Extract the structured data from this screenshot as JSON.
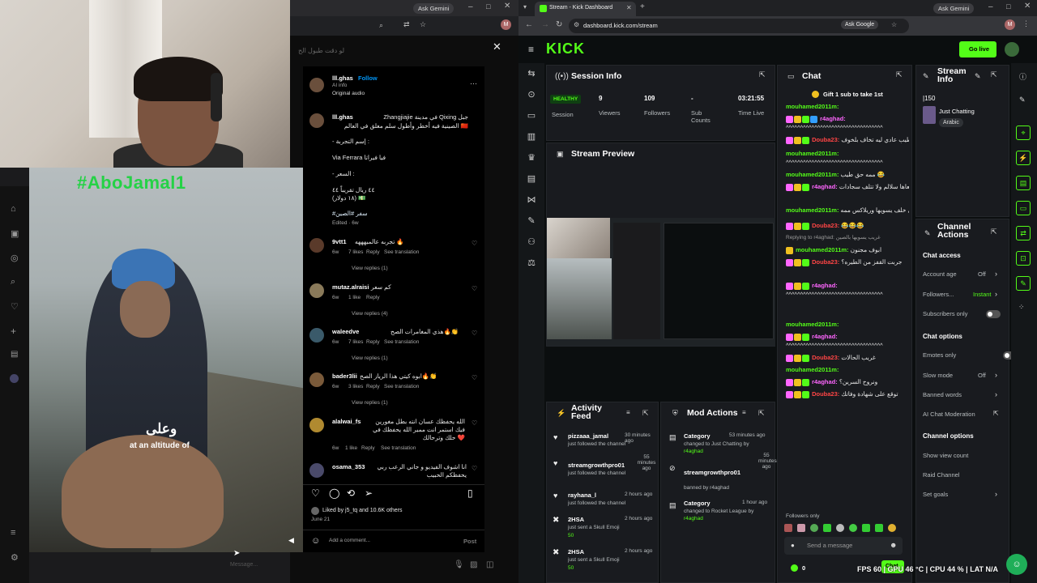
{
  "left_browser": {
    "ask_gemini": "Ask Gemini",
    "ig_header_text": "لو دقت طبول الح",
    "post": {
      "author": "lll.ghas",
      "follow": "Follow",
      "subtitle": "AI info",
      "audio": "Original audio",
      "caption_user": "lll.ghas",
      "caption_lines": [
        "Zhangjiajie في مدينة Qixing جبل",
        "الصينية فيه أخطر وأطول سلم معلق في العالم 🇨🇳",
        "- إسم التجربة :",
        "Via Ferrara فيا فيراتا",
        "- السعر :",
        "٤٤ ريال تقريباً ٤٤",
        "(١٨ دولار) 💵"
      ],
      "hashtag": "#سفر #الصين",
      "edited": "Edited · 6w"
    },
    "comments": [
      {
        "user": "9vtt1",
        "text": "تجربه عالميهههه 🔥",
        "time": "6w",
        "likes": "7 likes",
        "reply": "Reply",
        "translate": "See translation",
        "replies": "View replies (1)"
      },
      {
        "user": "mutaz.alraisi",
        "text": "كم سعر",
        "time": "6w",
        "likes": "1 like",
        "reply": "Reply",
        "translate": "",
        "replies": "View replies (4)"
      },
      {
        "user": "waleedve",
        "text": "هذي المغامرات الصح🔥👏",
        "time": "6w",
        "likes": "7 likes",
        "reply": "Reply",
        "translate": "See translation",
        "replies": "View replies (1)"
      },
      {
        "user": "bader3lii",
        "text": "ابوه كيتي هذا الرياز الصح🔥👏",
        "time": "6w",
        "likes": "3 likes",
        "reply": "Reply",
        "translate": "See translation",
        "replies": "View replies (1)"
      },
      {
        "user": "alalwai_fs",
        "text": "الله يحفظك عسان انته بطل مغورين فيك استمر انت ممير الله يحفظك في حلك وترحالك ❤️",
        "time": "6w",
        "likes": "1 like",
        "reply": "Reply",
        "translate": "See translation",
        "replies": ""
      },
      {
        "user": "osama_353",
        "text": "انا اشوف الفيديو و جاني الرعب ربي يحفظكم الحبيب",
        "time": "",
        "likes": "",
        "reply": "",
        "translate": "",
        "replies": ""
      }
    ],
    "liked_by": "Liked by j5_tq and 10.6K others",
    "date": "June 21",
    "add_comment": "Add a comment...",
    "post_btn": "Post",
    "overlay_tag": "#AboJamal1",
    "caption_ar": "وعلى",
    "caption_en": "at an altitude of",
    "message_placeholder": "Message..."
  },
  "right_browser": {
    "tab_title": "Stream - Kick Dashboard",
    "url": "dashboard.kick.com/stream",
    "ask_google": "Ask Google",
    "ask_gemini": "Ask Gemini",
    "logo": "KICK",
    "go_live": "Go live",
    "session": {
      "title": "Session Info",
      "status": "HEALTHY",
      "status_label": "Session",
      "viewers": "9",
      "viewers_label": "Viewers",
      "followers": "109",
      "followers_label": "Followers",
      "subs": "-",
      "subs_label": "Sub Counts",
      "time": "03:21:55",
      "time_label": "Time Live"
    },
    "preview_title": "Stream Preview",
    "activity": {
      "title": "Activity Feed",
      "items": [
        {
          "user": "pizzaaa_jamal",
          "action": "just followed the channel",
          "time": "30 minutes ago"
        },
        {
          "user": "streamgrowthpro01",
          "action": "just followed the channel",
          "time": "55 minutes ago"
        },
        {
          "user": "rayhana_l",
          "action": "just followed the channel",
          "time": "2 hours ago"
        },
        {
          "user": "2HSA",
          "action": "just sent a Skull Emoji",
          "time": "2 hours ago",
          "amount": "50"
        },
        {
          "user": "2HSA",
          "action": "just sent a Skull Emoji",
          "time": "2 hours ago",
          "amount": "50"
        }
      ]
    },
    "mod": {
      "title": "Mod Actions",
      "items": [
        {
          "title": "Category",
          "line1": "changed to Just Chatting by",
          "line2": "r4aghad",
          "time": "53 minutes ago"
        },
        {
          "title": "streamgrowthpro01",
          "line1": "banned by r4aghad",
          "line2": "",
          "time": "55 minutes ago"
        },
        {
          "title": "Category",
          "line1": "changed to Rocket League by",
          "line2": "r4aghad",
          "time": "1 hour ago"
        }
      ]
    },
    "chat": {
      "title": "Chat",
      "pinned": "Gift 1 sub to take 1st",
      "lines": [
        {
          "user": "mouhamed2011m:",
          "cls": "cu-g",
          "text": ""
        },
        {
          "user": "r4aghad:",
          "cls": "cu-p",
          "text": "^^^^^^^^^^^^^^^^^^^^^^^^^^^^^^^^^^"
        },
        {
          "user": "Douba23:",
          "cls": "cu-r",
          "text": "طيب عادي ليه تخاف بلخوف"
        },
        {
          "user": "mouhamed2011m:",
          "cls": "cu-g",
          "text": "^^^^^^^^^^^^^^^^^^^^^^^^^^^^^^^^^^"
        },
        {
          "user": "mouhamed2011m:",
          "cls": "cu-g",
          "text": "ممه حق طيب 😂"
        },
        {
          "user": "r4aghad:",
          "cls": "cu-p",
          "text": "السالفه زيي ليها كلاب بكيك بس احط معاها سلالم ولا تتلف سجادات"
        },
        {
          "user": "mouhamed2011m:",
          "cls": "cu-g",
          "text": "الي خلف يسويها وريلاكس ممه"
        },
        {
          "user": "Douba23:",
          "cls": "cu-r",
          "text": "😂😂😂"
        },
        {
          "user": "",
          "cls": "",
          "text": "Replying to r4aghad: غريب يسويها بالصين"
        },
        {
          "user": "mouhamed2011m:",
          "cls": "cu-g",
          "text": "ابوف مجنون"
        },
        {
          "user": "Douba23:",
          "cls": "cu-r",
          "text": "جربت القفز من الطيره؟"
        },
        {
          "user": "r4aghad:",
          "cls": "cu-p",
          "text": "^^^^^^^^^^^^^^^^^^^^^^^^^^^^^^^^^^"
        },
        {
          "user": "mouhamed2011m:",
          "cls": "cu-g",
          "text": ""
        },
        {
          "user": "r4aghad:",
          "cls": "cu-p",
          "text": "^^^^^^^^^^^^^^^^^^^^^^^^^^^^^^^^^^"
        },
        {
          "user": "Douba23:",
          "cls": "cu-r",
          "text": "غريب الحالات"
        },
        {
          "user": "mouhamed2011m:",
          "cls": "cu-g",
          "text": ""
        },
        {
          "user": "r4aghad:",
          "cls": "cu-p",
          "text": "ونروح السرين؟"
        },
        {
          "user": "Douba23:",
          "cls": "cu-r",
          "text": "توقع على شهادة وفاتك"
        }
      ],
      "followers_only": "Followers only",
      "send_placeholder": "Send a message",
      "points": "0",
      "chat_btn": "Chat"
    },
    "stream_info": {
      "title": "Stream Info",
      "name": "|150",
      "category": "Just Chatting",
      "tag": "Arabic"
    },
    "channel_actions": {
      "title": "Channel Actions",
      "chat_access": "Chat access",
      "account_age": "Account age",
      "account_age_val": "Off",
      "followers": "Followers...",
      "followers_val": "Instant",
      "subscribers_only": "Subscribers only",
      "chat_options": "Chat options",
      "emotes_only": "Emotes only",
      "slow_mode": "Slow mode",
      "slow_mode_val": "Off",
      "banned_words": "Banned words",
      "ai_mod": "AI Chat Moderation",
      "channel_options": "Channel options",
      "show_view_count": "Show view count",
      "raid_channel": "Raid Channel",
      "set_goals": "Set goals"
    },
    "stats_overlay": "FPS 60 | GPU 46 °C | CPU 44 % | LAT N/A"
  },
  "colors": {
    "kick_green": "#53fc18",
    "dark": "#0b0e0f",
    "panel": "#191b1f"
  }
}
